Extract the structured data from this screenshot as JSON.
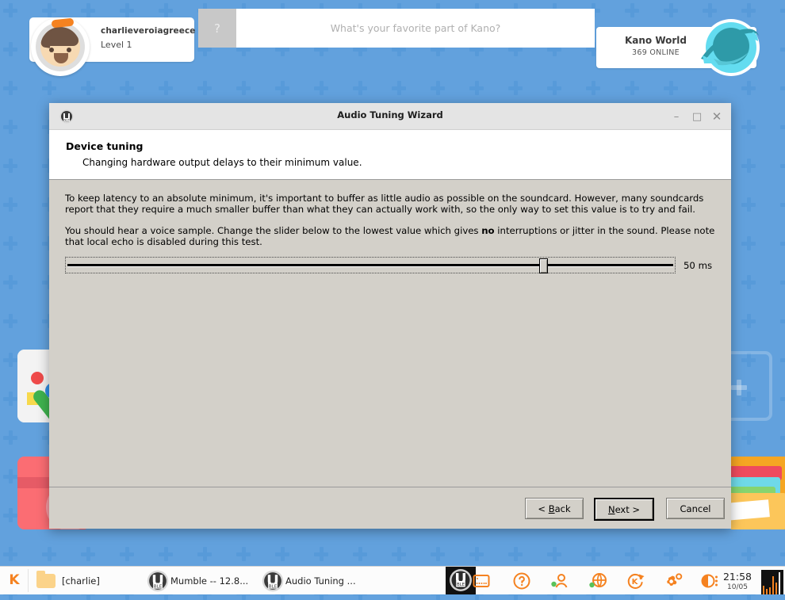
{
  "desktop": {
    "background_color": "#62a1dd",
    "pattern_color": "#579ad9",
    "tiles": [
      {
        "name": "make-art",
        "label": ""
      },
      {
        "name": "pong",
        "label": ""
      },
      {
        "name": "empty-slot",
        "label": ""
      },
      {
        "name": "files",
        "label": ""
      }
    ]
  },
  "topbar": {
    "profile": {
      "username": "charlieveroiagreece",
      "level": "Level 1",
      "avatar_icon": "avatar-face-icon"
    },
    "search": {
      "hint_glyph": "?",
      "placeholder": "What's your favorite part of Kano?",
      "value": ""
    },
    "kano_world": {
      "title": "Kano World",
      "online": "369 ONLINE",
      "planet_icon": "planet-icon"
    }
  },
  "wizard": {
    "window_icon": "mumble-icon",
    "title": "Audio Tuning Wizard",
    "window_buttons": {
      "minimize": "–",
      "maximize": "□",
      "close": "✕"
    },
    "header": {
      "title": "Device tuning",
      "subtitle": "Changing hardware output delays to their minimum value."
    },
    "body": {
      "paragraph1": "To keep latency to an absolute minimum, it's important to buffer as little audio as possible on the soundcard. However, many soundcards report that they require a much smaller buffer than what they can actually work with, so the only way to set this value is to try and fail.",
      "paragraph2_part1": "You should hear a voice sample. Change the slider below to the lowest value which gives ",
      "paragraph2_bold": "no",
      "paragraph2_part2": " interruptions or jitter in the sound. Please note that local echo is disabled during this test."
    },
    "slider": {
      "value_label": "50 ms",
      "value": 50,
      "min": 10,
      "max": 63,
      "fill_percent": 79
    },
    "footer": {
      "back": "< Back",
      "back_mnemonic": "B",
      "next": "Next >",
      "next_mnemonic": "N",
      "cancel": "Cancel",
      "default_button": "next"
    }
  },
  "taskbar": {
    "start_label": "K",
    "tasks": [
      {
        "name": "charlie",
        "label": "[charlie]",
        "icon": "folder-icon"
      },
      {
        "name": "mumble",
        "label": "Mumble -- 12.8...",
        "icon": "mumble-icon"
      },
      {
        "name": "audio-tuning",
        "label": "Audio Tuning ...",
        "icon": "mumble-icon"
      }
    ],
    "tray_icons": [
      "screen-icon",
      "help-icon",
      "user-status-icon",
      "globe-status-icon",
      "kano-refresh-icon",
      "settings-gear-icon",
      "contrast-menu-icon"
    ],
    "clock": {
      "time": "21:58",
      "date": "10/05"
    },
    "accent_color": "#f58220"
  }
}
